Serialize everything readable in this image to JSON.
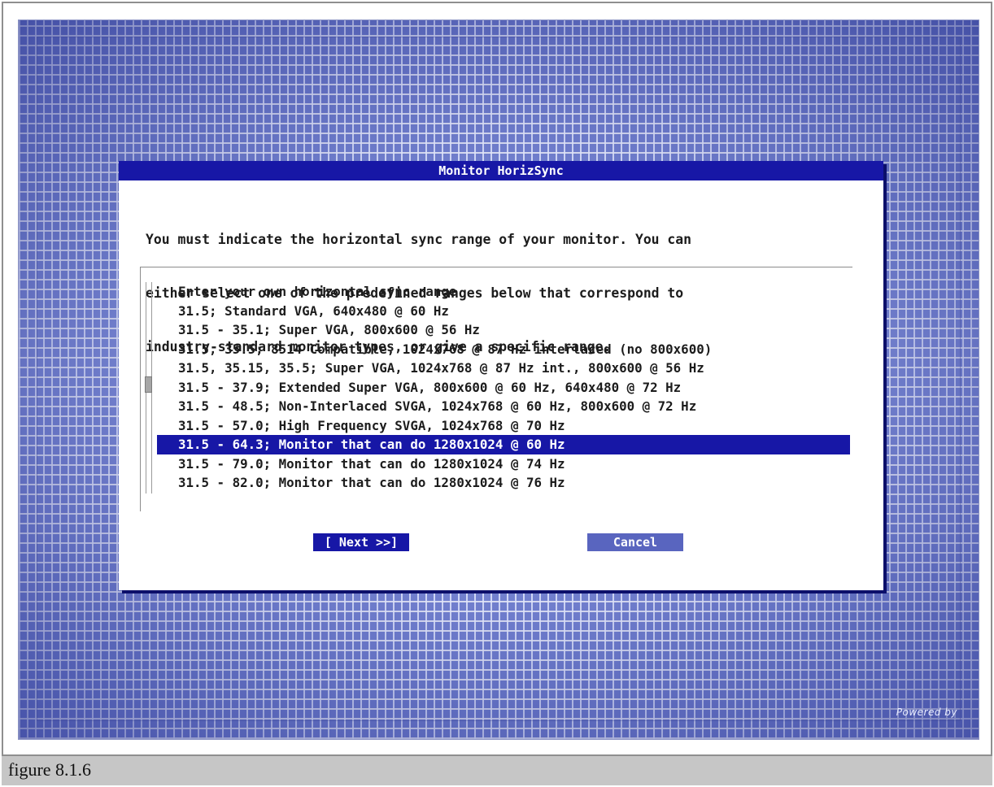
{
  "dialog": {
    "title": "Monitor HorizSync",
    "prompt_lines": [
      "You must indicate the horizontal sync range of your monitor. You can",
      "either select one of the predefined ranges below that correspond to",
      "industry-standard monitor types, or give a specific range."
    ],
    "options": [
      "Enter your own horizontal sync range",
      "31.5; Standard VGA, 640x480 @ 60 Hz",
      "31.5 - 35.1; Super VGA, 800x600 @ 56 Hz",
      "31.5, 35.5; 8514 Compatible, 1024x768 @ 87 Hz interlaced (no 800x600)",
      "31.5, 35.15, 35.5; Super VGA, 1024x768 @ 87 Hz int., 800x600 @ 56 Hz",
      "31.5 - 37.9; Extended Super VGA, 800x600 @ 60 Hz, 640x480 @ 72 Hz",
      "31.5 - 48.5; Non-Interlaced SVGA, 1024x768 @ 60 Hz, 800x600 @ 72 Hz",
      "31.5 - 57.0; High Frequency SVGA, 1024x768 @ 70 Hz",
      "31.5 - 64.3; Monitor that can do 1280x1024 @ 60 Hz",
      "31.5 - 79.0; Monitor that can do 1280x1024 @ 74 Hz",
      "31.5 - 82.0; Monitor that can do 1280x1024 @ 76 Hz"
    ],
    "selected_index": 8,
    "next_label": "[ Next >>]",
    "cancel_label": "Cancel"
  },
  "watermark": "Powered by",
  "caption": "figure 8.1.6",
  "colors": {
    "title_bar": "#1717a6",
    "selection": "#1717a6",
    "cancel_button": "#5965bf",
    "caption_bg": "#c6c6c6"
  }
}
